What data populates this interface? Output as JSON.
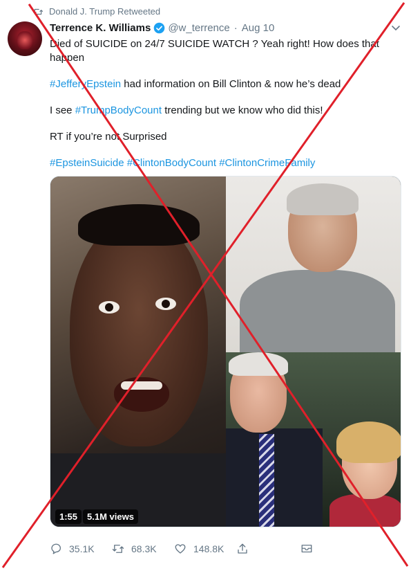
{
  "retweet_banner": "Donald J. Trump Retweeted",
  "author": {
    "name": "Terrence K. Williams",
    "handle": "@w_terrence",
    "separator": "·",
    "date": "Aug 10"
  },
  "tweet": {
    "line1": "Died of SUICIDE on 24/7 SUICIDE WATCH ? Yeah right! How does that happen",
    "line2_hashtag": "#JefferyEpstein",
    "line2_rest": " had information on Bill Clinton & now he’s dead",
    "line3_pre": "I see ",
    "line3_hashtag": "#TrumpBodyCount",
    "line3_rest": " trending but we know who did this!",
    "line4": "RT if you’re not Surprised",
    "hashtags": [
      "#EpsteinSuicide",
      "#ClintonBodyCount",
      "#ClintonCrimeFamily"
    ]
  },
  "media": {
    "duration": "1:55",
    "views": "5.1M views"
  },
  "actions": {
    "replies": "35.1K",
    "retweets": "68.3K",
    "likes": "148.8K"
  },
  "icons": [
    "retweet-icon",
    "verified-badge-icon",
    "chevron-down-icon",
    "reply-icon",
    "retweet-action-icon",
    "heart-icon",
    "share-icon",
    "dm-icon"
  ],
  "colors": {
    "hashtag": "#1b95e0",
    "muted": "#657786",
    "cross": "#e0202a",
    "verified": "#1da1f2"
  }
}
